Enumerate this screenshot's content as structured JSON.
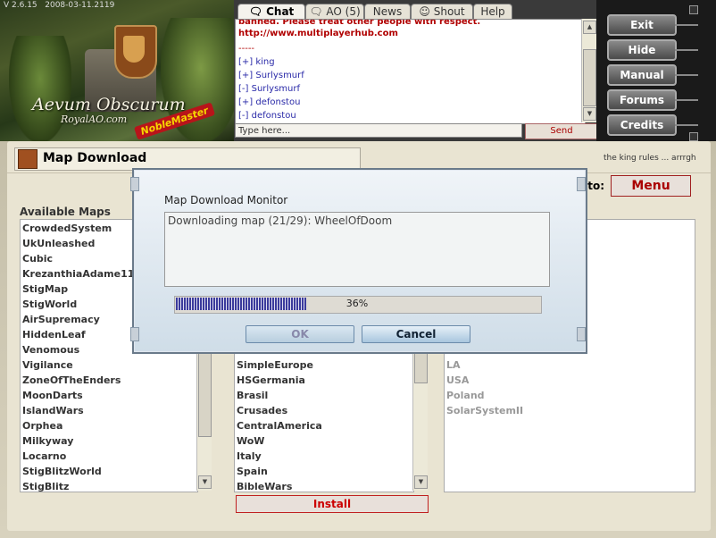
{
  "app": {
    "version": "V 2.6.15",
    "build_date": "2008-03-11.2119",
    "logo_title": "Aevum Obscurum",
    "logo_subtitle": "RoyalAO.com",
    "brand_badge": "NobleMaster"
  },
  "chat": {
    "tabs": [
      {
        "label": "Chat (5)",
        "icon": "speech-bubble-icon",
        "active": true
      },
      {
        "label": "AO (5)",
        "icon": "speech-bubble-icon",
        "active": false
      },
      {
        "label": "News",
        "active": false
      },
      {
        "label": "Shout",
        "icon": "shout-icon",
        "active": false
      },
      {
        "label": "Help",
        "active": false
      }
    ],
    "lines": [
      {
        "text": "banned. Please treat other people with respect.",
        "style": "red"
      },
      {
        "text": "http://www.multiplayerhub.com",
        "style": "red-link"
      },
      {
        "text": "-----",
        "style": "red"
      },
      {
        "text": "[+] king",
        "style": "blue"
      },
      {
        "text": "[+] Surlysmurf",
        "style": "blue"
      },
      {
        "text": "[-] Surlysmurf",
        "style": "blue"
      },
      {
        "text": "[+] defonstou",
        "style": "blue"
      },
      {
        "text": "[-] defonstou",
        "style": "blue"
      }
    ],
    "input_placeholder": "Type here...",
    "send_label": "Send"
  },
  "right_buttons": [
    "Exit",
    "Hide",
    "Manual",
    "Forums",
    "Credits"
  ],
  "panel": {
    "title": "Map Download",
    "motd": "the king rules ... arrrgh",
    "goto_label": "oto:",
    "menu_label": "Menu",
    "available_label": "Available Maps",
    "available_maps": [
      "CrowdedSystem",
      "UkUnleashed",
      "Cubic",
      "KrezanthiaAdame11",
      "StigMap",
      "StigWorld",
      "AirSupremacy",
      "HiddenLeaf",
      "Venomous",
      "Vigilance",
      "ZoneOfTheEnders",
      "MoonDarts",
      "IslandWars",
      "Orphea",
      "Milkyway",
      "Locarno",
      "StigBlitzWorld",
      "StigBlitz"
    ],
    "middle_maps": [
      "SimpleEurope",
      "HSGermania",
      "Brasil",
      "Crusades",
      "CentralAmerica",
      "WoW",
      "Italy",
      "Spain",
      "BibleWars"
    ],
    "right_maps": [
      "LA",
      "USA",
      "Poland",
      "SolarSystemII"
    ],
    "install_label": "Install"
  },
  "modal": {
    "title": "Map Download Monitor",
    "status": "Downloading map (21/29): WheelOfDoom",
    "progress_percent": 36,
    "progress_label": "36%",
    "ok_label": "OK",
    "cancel_label": "Cancel"
  },
  "colors": {
    "accent_red": "#b00000",
    "chat_blue": "#2a2aa8",
    "progress_blue": "#3b3b9c",
    "modal_bg": "#dbe6ee"
  }
}
